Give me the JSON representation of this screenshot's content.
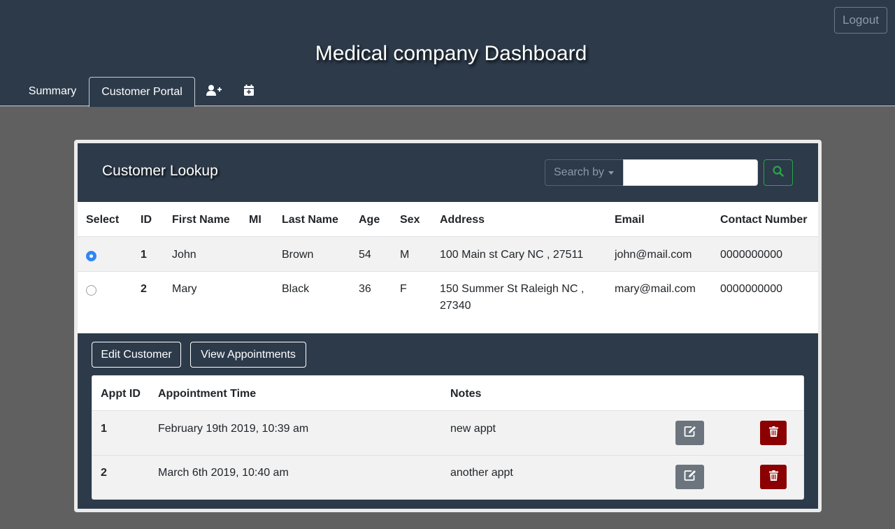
{
  "header": {
    "title": "Medical company Dashboard",
    "logout_label": "Logout",
    "tabs": [
      {
        "label": "Summary"
      },
      {
        "label": "Customer Portal",
        "active": true
      },
      {
        "icon": "add-user-icon"
      },
      {
        "icon": "calendar-plus-icon"
      }
    ]
  },
  "lookup": {
    "title": "Customer Lookup",
    "search_by_label": "Search by",
    "search_value": "",
    "search_icon": "search-icon"
  },
  "customers": {
    "columns": [
      "Select",
      "ID",
      "First Name",
      "MI",
      "Last Name",
      "Age",
      "Sex",
      "Address",
      "Email",
      "Contact Number"
    ],
    "rows": [
      {
        "selected": true,
        "id": "1",
        "first": "John",
        "mi": "",
        "last": "Brown",
        "age": "54",
        "sex": "M",
        "address_line1": "100 Main st Cary NC , 27511",
        "address_line2": "",
        "email": "john@mail.com",
        "phone": "0000000000"
      },
      {
        "selected": false,
        "id": "2",
        "first": "Mary",
        "mi": "",
        "last": "Black",
        "age": "36",
        "sex": "F",
        "address_line1": "150 Summer St Raleigh NC ,",
        "address_line2": "27340",
        "email": "mary@mail.com",
        "phone": "0000000000"
      }
    ]
  },
  "actions": {
    "edit_customer": "Edit Customer",
    "view_appointments": "View Appointments"
  },
  "appointments": {
    "columns": [
      "Appt ID",
      "Appointment Time",
      "Notes"
    ],
    "rows": [
      {
        "id": "1",
        "time": "February 19th 2019, 10:39 am",
        "notes": "new appt"
      },
      {
        "id": "2",
        "time": "March 6th 2019, 10:40 am",
        "notes": "another appt"
      }
    ]
  },
  "colors": {
    "header_bg": "#2c3a4a",
    "page_bg": "#606060",
    "radio_selected": "#2f86f6",
    "search_button": "#28a745",
    "edit_button": "#6c757d",
    "delete_button": "#8b0000"
  }
}
